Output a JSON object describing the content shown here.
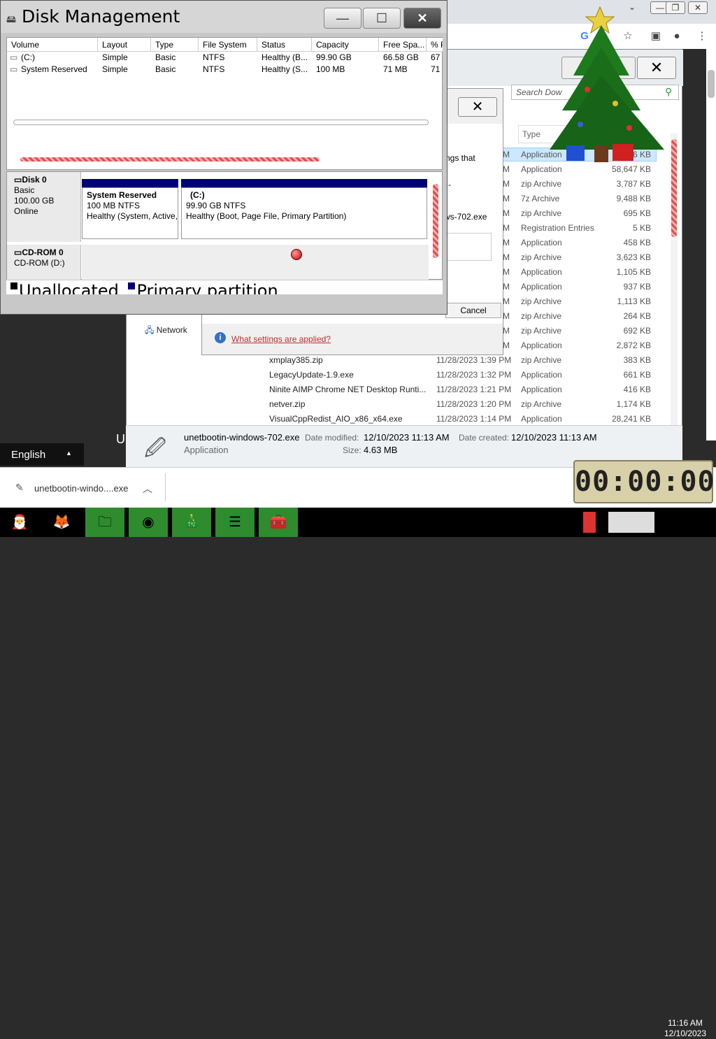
{
  "chrome": {
    "min": "⌄",
    "restore": "❐",
    "close": "✕"
  },
  "explorer": {
    "search_placeholder": "Search Dow",
    "type_header": "Type",
    "rows": [
      {
        "name": "",
        "date": "",
        "type": "Application",
        "size": "246 KB"
      },
      {
        "name": "",
        "date": "",
        "type": "Application",
        "size": "58,647 KB"
      },
      {
        "name": "",
        "date": "",
        "type": "zip Archive",
        "size": "3,787 KB"
      },
      {
        "name": "",
        "date": "",
        "type": "7z Archive",
        "size": "9,488 KB"
      },
      {
        "name": "",
        "date": "",
        "type": "zip Archive",
        "size": "695 KB"
      },
      {
        "name": "",
        "date": "",
        "type": "Registration Entries",
        "size": "5 KB"
      },
      {
        "name": "",
        "date": "",
        "type": "Application",
        "size": "458 KB"
      },
      {
        "name": "",
        "date": "",
        "type": "zip Archive",
        "size": "3,623 KB"
      },
      {
        "name": "",
        "date": "",
        "type": "Application",
        "size": "1,105 KB"
      },
      {
        "name": "",
        "date": "",
        "type": "Application",
        "size": "937 KB"
      },
      {
        "name": "",
        "date": "",
        "type": "zip Archive",
        "size": "1,113 KB"
      },
      {
        "name": "",
        "date": "",
        "type": "zip Archive",
        "size": "264 KB"
      },
      {
        "name": "",
        "date": "",
        "type": "zip Archive",
        "size": "692 KB"
      },
      {
        "name": "",
        "date": "",
        "type": "Application",
        "size": "2,872 KB"
      },
      {
        "name": "xmplay385.zip",
        "date": "11/28/2023 1:39 PM",
        "type": "zip Archive",
        "size": "383 KB"
      },
      {
        "name": "LegacyUpdate-1.9.exe",
        "date": "11/28/2023 1:32 PM",
        "type": "Application",
        "size": "661 KB"
      },
      {
        "name": "Ninite AIMP Chrome NET Desktop Runti...",
        "date": "11/28/2023 1:21 PM",
        "type": "Application",
        "size": "416 KB"
      },
      {
        "name": "netver.zip",
        "date": "11/28/2023 1:20 PM",
        "type": "zip Archive",
        "size": "1,174 KB"
      },
      {
        "name": "VisualCppRedist_AIO_x86_x64.exe",
        "date": "11/28/2023 1:14 PM",
        "type": "Application",
        "size": "28,241 KB"
      }
    ],
    "partial_label": "M",
    "network_label": "Network",
    "details": {
      "filename": "unetbootin-windows-702.exe",
      "kind": "Application",
      "modified_label": "Date modified:",
      "modified": "12/10/2023 11:13 AM",
      "created_label": "Date created:",
      "created": "12/10/2023 11:13 AM",
      "size_label": "Size:",
      "size": "4.63 MB"
    }
  },
  "dialog": {
    "text1": "ngs that",
    "text2": "-",
    "text3": "ws-702.exe",
    "cancel": "Cancel",
    "link": "What settings are applied?",
    "close": "✕"
  },
  "disk_management": {
    "title": "Disk Management",
    "min": "—",
    "max": "☐",
    "close": "✕",
    "headers": [
      "Volume",
      "Layout",
      "Type",
      "File System",
      "Status",
      "Capacity",
      "Free Spa...",
      "% F"
    ],
    "volumes": [
      [
        "(C:)",
        "Simple",
        "Basic",
        "NTFS",
        "Healthy (B...",
        "99.90 GB",
        "66.58 GB",
        "67"
      ],
      [
        "System Reserved",
        "Simple",
        "Basic",
        "NTFS",
        "Healthy (S...",
        "100 MB",
        "71 MB",
        "71"
      ]
    ],
    "disk0": {
      "name": "Disk 0",
      "type": "Basic",
      "size": "100.00 GB",
      "state": "Online"
    },
    "part1": {
      "name": "System Reserved",
      "size": "100 MB NTFS",
      "status": "Healthy (System, Active,"
    },
    "part2": {
      "name": "(C:)",
      "size": "99.90 GB NTFS",
      "status": "Healthy (Boot, Page File, Primary Partition)"
    },
    "cdrom": {
      "name": "CD-ROM 0",
      "detail": "CD-ROM (D:)"
    },
    "legend": {
      "unallocated": "Unallocated",
      "primary": "Primary partition"
    }
  },
  "language": "English",
  "language_arrow": "▲",
  "side_letter": "U",
  "download": {
    "file": "unetbootin-windo....exe"
  },
  "timer": "00:00:00",
  "clock": {
    "time": "11:16 AM",
    "date": "12/10/2023"
  },
  "colors": {
    "partition_bar": "#00007a",
    "scroll_accent": "#e05050"
  }
}
